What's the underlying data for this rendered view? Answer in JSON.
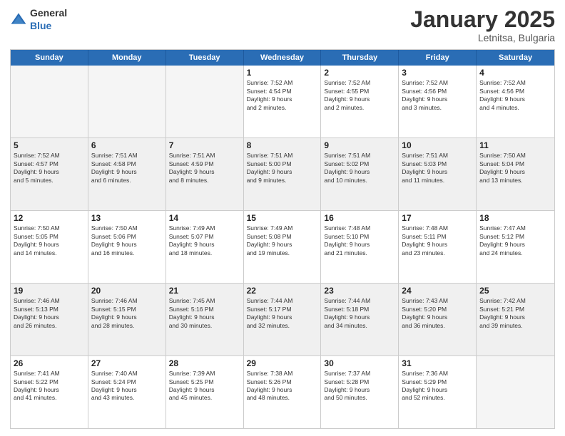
{
  "header": {
    "logo_general": "General",
    "logo_blue": "Blue",
    "month": "January 2025",
    "location": "Letnitsa, Bulgaria"
  },
  "days_of_week": [
    "Sunday",
    "Monday",
    "Tuesday",
    "Wednesday",
    "Thursday",
    "Friday",
    "Saturday"
  ],
  "weeks": [
    [
      {
        "day": "",
        "empty": true
      },
      {
        "day": "",
        "empty": true
      },
      {
        "day": "",
        "empty": true
      },
      {
        "day": "1",
        "lines": [
          "Sunrise: 7:52 AM",
          "Sunset: 4:54 PM",
          "Daylight: 9 hours",
          "and 2 minutes."
        ]
      },
      {
        "day": "2",
        "lines": [
          "Sunrise: 7:52 AM",
          "Sunset: 4:55 PM",
          "Daylight: 9 hours",
          "and 2 minutes."
        ]
      },
      {
        "day": "3",
        "lines": [
          "Sunrise: 7:52 AM",
          "Sunset: 4:56 PM",
          "Daylight: 9 hours",
          "and 3 minutes."
        ]
      },
      {
        "day": "4",
        "lines": [
          "Sunrise: 7:52 AM",
          "Sunset: 4:56 PM",
          "Daylight: 9 hours",
          "and 4 minutes."
        ]
      }
    ],
    [
      {
        "day": "5",
        "lines": [
          "Sunrise: 7:52 AM",
          "Sunset: 4:57 PM",
          "Daylight: 9 hours",
          "and 5 minutes."
        ]
      },
      {
        "day": "6",
        "lines": [
          "Sunrise: 7:51 AM",
          "Sunset: 4:58 PM",
          "Daylight: 9 hours",
          "and 6 minutes."
        ]
      },
      {
        "day": "7",
        "lines": [
          "Sunrise: 7:51 AM",
          "Sunset: 4:59 PM",
          "Daylight: 9 hours",
          "and 8 minutes."
        ]
      },
      {
        "day": "8",
        "lines": [
          "Sunrise: 7:51 AM",
          "Sunset: 5:00 PM",
          "Daylight: 9 hours",
          "and 9 minutes."
        ]
      },
      {
        "day": "9",
        "lines": [
          "Sunrise: 7:51 AM",
          "Sunset: 5:02 PM",
          "Daylight: 9 hours",
          "and 10 minutes."
        ]
      },
      {
        "day": "10",
        "lines": [
          "Sunrise: 7:51 AM",
          "Sunset: 5:03 PM",
          "Daylight: 9 hours",
          "and 11 minutes."
        ]
      },
      {
        "day": "11",
        "lines": [
          "Sunrise: 7:50 AM",
          "Sunset: 5:04 PM",
          "Daylight: 9 hours",
          "and 13 minutes."
        ]
      }
    ],
    [
      {
        "day": "12",
        "lines": [
          "Sunrise: 7:50 AM",
          "Sunset: 5:05 PM",
          "Daylight: 9 hours",
          "and 14 minutes."
        ]
      },
      {
        "day": "13",
        "lines": [
          "Sunrise: 7:50 AM",
          "Sunset: 5:06 PM",
          "Daylight: 9 hours",
          "and 16 minutes."
        ]
      },
      {
        "day": "14",
        "lines": [
          "Sunrise: 7:49 AM",
          "Sunset: 5:07 PM",
          "Daylight: 9 hours",
          "and 18 minutes."
        ]
      },
      {
        "day": "15",
        "lines": [
          "Sunrise: 7:49 AM",
          "Sunset: 5:08 PM",
          "Daylight: 9 hours",
          "and 19 minutes."
        ]
      },
      {
        "day": "16",
        "lines": [
          "Sunrise: 7:48 AM",
          "Sunset: 5:10 PM",
          "Daylight: 9 hours",
          "and 21 minutes."
        ]
      },
      {
        "day": "17",
        "lines": [
          "Sunrise: 7:48 AM",
          "Sunset: 5:11 PM",
          "Daylight: 9 hours",
          "and 23 minutes."
        ]
      },
      {
        "day": "18",
        "lines": [
          "Sunrise: 7:47 AM",
          "Sunset: 5:12 PM",
          "Daylight: 9 hours",
          "and 24 minutes."
        ]
      }
    ],
    [
      {
        "day": "19",
        "lines": [
          "Sunrise: 7:46 AM",
          "Sunset: 5:13 PM",
          "Daylight: 9 hours",
          "and 26 minutes."
        ]
      },
      {
        "day": "20",
        "lines": [
          "Sunrise: 7:46 AM",
          "Sunset: 5:15 PM",
          "Daylight: 9 hours",
          "and 28 minutes."
        ]
      },
      {
        "day": "21",
        "lines": [
          "Sunrise: 7:45 AM",
          "Sunset: 5:16 PM",
          "Daylight: 9 hours",
          "and 30 minutes."
        ]
      },
      {
        "day": "22",
        "lines": [
          "Sunrise: 7:44 AM",
          "Sunset: 5:17 PM",
          "Daylight: 9 hours",
          "and 32 minutes."
        ]
      },
      {
        "day": "23",
        "lines": [
          "Sunrise: 7:44 AM",
          "Sunset: 5:18 PM",
          "Daylight: 9 hours",
          "and 34 minutes."
        ]
      },
      {
        "day": "24",
        "lines": [
          "Sunrise: 7:43 AM",
          "Sunset: 5:20 PM",
          "Daylight: 9 hours",
          "and 36 minutes."
        ]
      },
      {
        "day": "25",
        "lines": [
          "Sunrise: 7:42 AM",
          "Sunset: 5:21 PM",
          "Daylight: 9 hours",
          "and 39 minutes."
        ]
      }
    ],
    [
      {
        "day": "26",
        "lines": [
          "Sunrise: 7:41 AM",
          "Sunset: 5:22 PM",
          "Daylight: 9 hours",
          "and 41 minutes."
        ]
      },
      {
        "day": "27",
        "lines": [
          "Sunrise: 7:40 AM",
          "Sunset: 5:24 PM",
          "Daylight: 9 hours",
          "and 43 minutes."
        ]
      },
      {
        "day": "28",
        "lines": [
          "Sunrise: 7:39 AM",
          "Sunset: 5:25 PM",
          "Daylight: 9 hours",
          "and 45 minutes."
        ]
      },
      {
        "day": "29",
        "lines": [
          "Sunrise: 7:38 AM",
          "Sunset: 5:26 PM",
          "Daylight: 9 hours",
          "and 48 minutes."
        ]
      },
      {
        "day": "30",
        "lines": [
          "Sunrise: 7:37 AM",
          "Sunset: 5:28 PM",
          "Daylight: 9 hours",
          "and 50 minutes."
        ]
      },
      {
        "day": "31",
        "lines": [
          "Sunrise: 7:36 AM",
          "Sunset: 5:29 PM",
          "Daylight: 9 hours",
          "and 52 minutes."
        ]
      },
      {
        "day": "",
        "empty": true
      }
    ]
  ]
}
